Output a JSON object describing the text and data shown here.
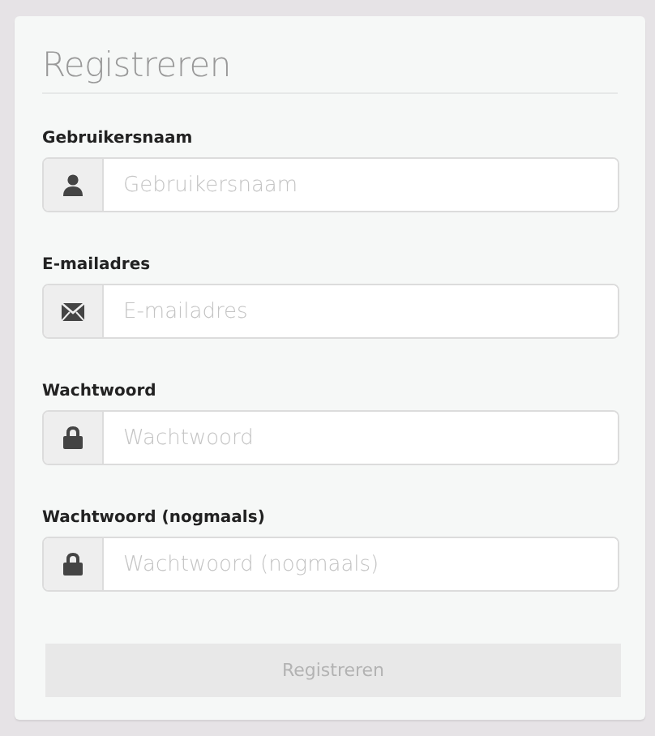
{
  "title": "Registreren",
  "fields": [
    {
      "label": "Gebruikersnaam",
      "placeholder": "Gebruikersnaam",
      "kind": "username"
    },
    {
      "label": "E-mailadres",
      "placeholder": "E-mailadres",
      "kind": "email"
    },
    {
      "label": "Wachtwoord",
      "placeholder": "Wachtwoord",
      "kind": "password"
    },
    {
      "label": "Wachtwoord (nogmaals)",
      "placeholder": "Wachtwoord (nogmaals)",
      "kind": "password"
    }
  ],
  "submit": {
    "label": "Registreren",
    "disabled": true
  }
}
